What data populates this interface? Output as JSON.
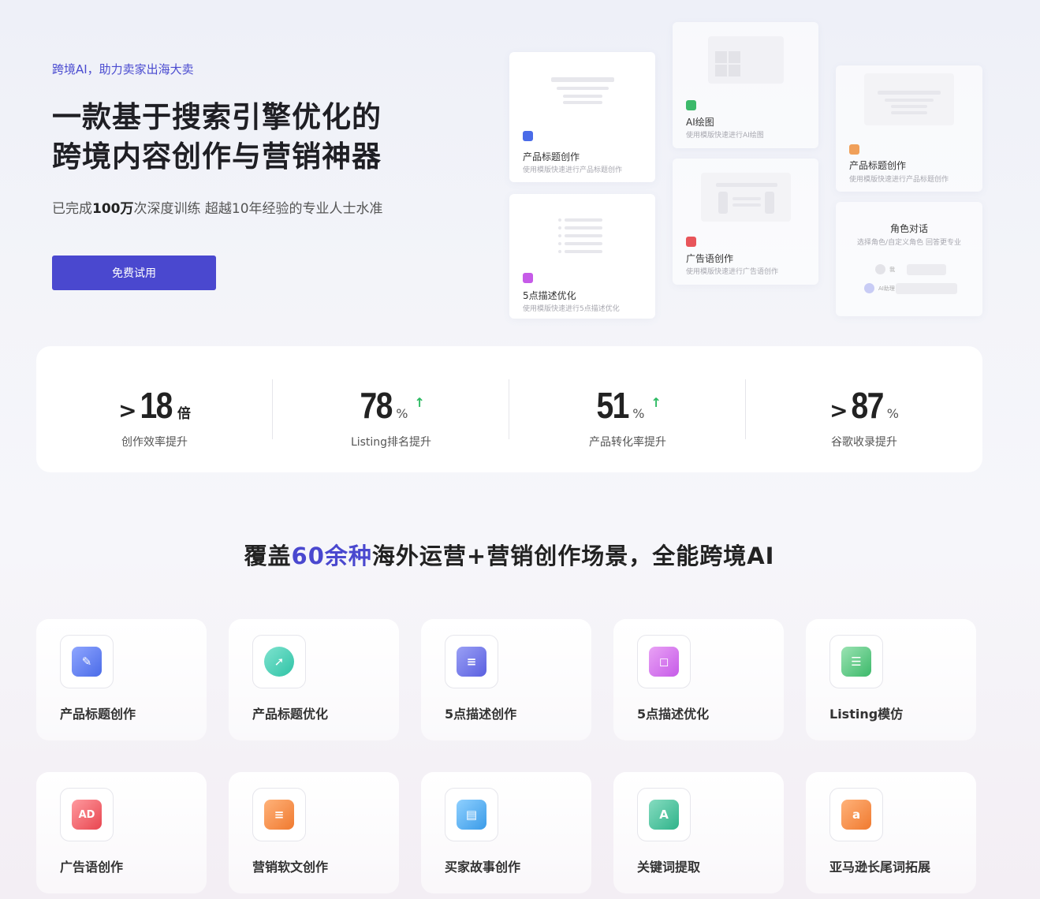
{
  "hero": {
    "tagline": "跨境AI，助力卖家出海大卖",
    "headline_line1": "一款基于搜索引擎优化的",
    "headline_line2": "跨境内容创作与营销神器",
    "subline_pre": "已完成",
    "subline_bold": "100万",
    "subline_post": "次深度训练 超越10年经验的专业人士水准",
    "cta_label": "免费试用"
  },
  "preview_cards": [
    {
      "title": "产品标题创作",
      "desc": "使用模版快速进行产品标题创作",
      "icon_color": "#4a6be8"
    },
    {
      "title": "5点描述优化",
      "desc": "使用模版快速进行5点描述优化",
      "icon_color": "#c65be8"
    },
    {
      "title": "AI绘图",
      "desc": "使用模版快速进行AI绘图",
      "icon_color": "#3cb96a"
    },
    {
      "title": "广告语创作",
      "desc": "使用模版快速进行广告语创作",
      "icon_color": "#e8555a"
    },
    {
      "title": "产品标题创作",
      "desc": "使用模版快速进行产品标题创作",
      "icon_color": "#f0a05a"
    },
    {
      "title": "角色对话",
      "desc": "选择角色/自定义角色 回答更专业",
      "user_label": "我",
      "ai_label": "AI助理"
    }
  ],
  "stats": [
    {
      "prefix": ">",
      "value": "18",
      "unit": "倍",
      "pct": "",
      "up": false,
      "label": "创作效率提升"
    },
    {
      "prefix": "",
      "value": "78",
      "unit": "",
      "pct": "%",
      "up": true,
      "label": "Listing排名提升"
    },
    {
      "prefix": "",
      "value": "51",
      "unit": "",
      "pct": "%",
      "up": true,
      "label": "产品转化率提升"
    },
    {
      "prefix": ">",
      "value": "87",
      "unit": "",
      "pct": "%",
      "up": false,
      "label": "谷歌收录提升"
    }
  ],
  "section": {
    "title_pre": "覆盖",
    "title_hl": "60余种",
    "title_post": "海外运营+营销创作场景，全能跨境AI"
  },
  "features": [
    {
      "label": "产品标题创作",
      "icon": "pencil-doc-icon",
      "color": "#4a6be8",
      "glyph": "✎"
    },
    {
      "label": "产品标题优化",
      "icon": "rocket-icon",
      "color": "#2fc3a6",
      "glyph": "➚"
    },
    {
      "label": "5点描述创作",
      "icon": "document-icon",
      "color": "#5a5fe0",
      "glyph": "≡"
    },
    {
      "label": "5点描述优化",
      "icon": "bag-icon",
      "color": "#c65be8",
      "glyph": "◻"
    },
    {
      "label": "Listing模仿",
      "icon": "clipboard-icon",
      "color": "#3cb96a",
      "glyph": "☰"
    },
    {
      "label": "广告语创作",
      "icon": "ad-icon",
      "color": "#e8454f",
      "glyph": "AD"
    },
    {
      "label": "营销软文创作",
      "icon": "new-article-icon",
      "color": "#f07a2f",
      "glyph": "≡"
    },
    {
      "label": "买家故事创作",
      "icon": "book-icon",
      "color": "#3a9be8",
      "glyph": "▤"
    },
    {
      "label": "关键词提取",
      "icon": "keyword-search-icon",
      "color": "#2fb38a",
      "glyph": "A"
    },
    {
      "label": "亚马逊长尾词拓展",
      "icon": "amazon-icon",
      "color": "#f07a2f",
      "glyph": "a"
    }
  ]
}
